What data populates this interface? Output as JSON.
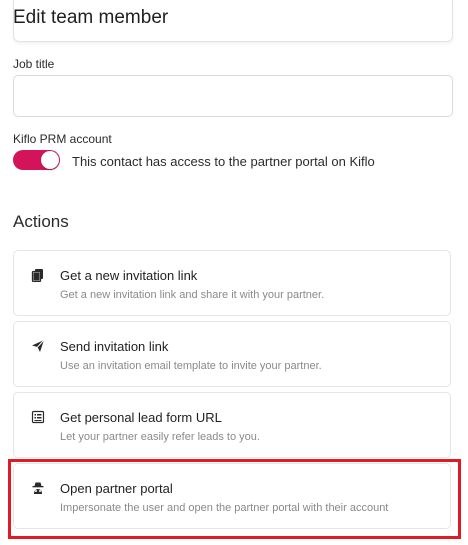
{
  "header": {
    "title": "Edit team member"
  },
  "job_title": {
    "label": "Job title",
    "value": "",
    "placeholder": ""
  },
  "kiflo": {
    "label": "Kiflo PRM account",
    "toggle_on": true,
    "toggle_text": "This contact has access to the partner portal on Kiflo",
    "accent_color": "#d4145a"
  },
  "actions": {
    "title": "Actions",
    "items": [
      {
        "icon": "copy-icon",
        "title": "Get a new invitation link",
        "description": "Get a new invitation link and share it with your partner."
      },
      {
        "icon": "send-icon",
        "title": "Send invitation link",
        "description": "Use an invitation email template to invite your partner."
      },
      {
        "icon": "form-icon",
        "title": "Get personal lead form URL",
        "description": "Let your partner easily refer leads to you."
      },
      {
        "icon": "incognito-icon",
        "title": "Open partner portal",
        "description": "Impersonate the user and open the partner portal with their account"
      }
    ]
  },
  "highlight_color": "#e01b24"
}
